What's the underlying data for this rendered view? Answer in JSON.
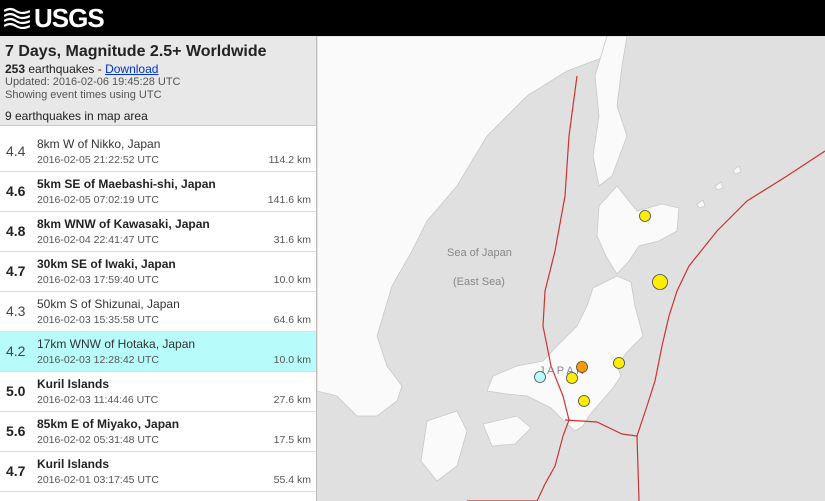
{
  "app": {
    "logo_text": "USGS"
  },
  "header": {
    "title": "7 Days, Magnitude 2.5+ Worldwide",
    "count_value": "253",
    "count_suffix": " earthquakes - ",
    "download_label": "Download",
    "updated": "Updated: 2016-02-06 19:45:28 UTC",
    "timezone_note": "Showing event times using UTC",
    "in_map_area": "9 earthquakes in map area"
  },
  "events": [
    {
      "mag": "4.4",
      "place": "8km W of Nikko, Japan",
      "time": "2016-02-05 21:22:52 UTC",
      "depth": "114.2 km",
      "bold": false,
      "selected": false
    },
    {
      "mag": "4.6",
      "place": "5km SE of Maebashi-shi, Japan",
      "time": "2016-02-05 07:02:19 UTC",
      "depth": "141.6 km",
      "bold": true,
      "selected": false
    },
    {
      "mag": "4.8",
      "place": "8km WNW of Kawasaki, Japan",
      "time": "2016-02-04 22:41:47 UTC",
      "depth": "31.6 km",
      "bold": true,
      "selected": false
    },
    {
      "mag": "4.7",
      "place": "30km SE of Iwaki, Japan",
      "time": "2016-02-03 17:59:40 UTC",
      "depth": "10.0 km",
      "bold": true,
      "selected": false
    },
    {
      "mag": "4.3",
      "place": "50km S of Shizunai, Japan",
      "time": "2016-02-03 15:35:58 UTC",
      "depth": "64.6 km",
      "bold": false,
      "selected": false
    },
    {
      "mag": "4.2",
      "place": "17km WNW of Hotaka, Japan",
      "time": "2016-02-03 12:28:42 UTC",
      "depth": "10.0 km",
      "bold": false,
      "selected": true
    },
    {
      "mag": "5.0",
      "place": "Kuril Islands",
      "time": "2016-02-03 11:44:46 UTC",
      "depth": "27.6 km",
      "bold": true,
      "selected": false
    },
    {
      "mag": "5.6",
      "place": "85km E of Miyako, Japan",
      "time": "2016-02-02 05:31:48 UTC",
      "depth": "17.5 km",
      "bold": true,
      "selected": false
    },
    {
      "mag": "4.7",
      "place": "Kuril Islands",
      "time": "2016-02-01 03:17:45 UTC",
      "depth": "55.4 km",
      "bold": true,
      "selected": false
    }
  ],
  "map": {
    "sea_label_1": "Sea of Japan",
    "sea_label_2": "(East Sea)",
    "country_label": "J A P A N",
    "colors": {
      "water": "#e0e0e0",
      "land": "#fafafa",
      "plate": "#cc3333",
      "quake_old": "#ffee00",
      "quake_day": "#ff9900",
      "quake_selected": "#b7fbfb"
    }
  }
}
